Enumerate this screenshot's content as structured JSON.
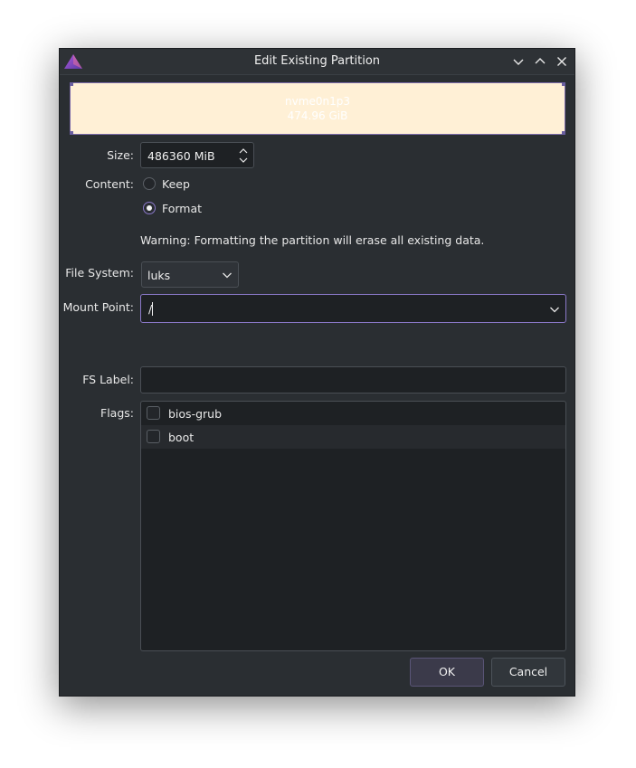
{
  "window": {
    "title": "Edit Existing Partition"
  },
  "partition": {
    "name": "nvme0n1p3",
    "size": "474.96 GiB",
    "color": "#fff0d6"
  },
  "form": {
    "size_label": "Size:",
    "size_value": "486360 MiB",
    "content_label": "Content:",
    "content_options": [
      "Keep",
      "Format"
    ],
    "content_selected": "Format",
    "warning": "Warning: Formatting the partition will erase all existing data.",
    "filesystem_label": "File System:",
    "filesystem_value": "luks",
    "mount_label": "Mount Point:",
    "mount_value": "/",
    "fslabel_label": "FS Label:",
    "fslabel_value": "",
    "flags_label": "Flags:",
    "flags": [
      {
        "label": "bios-grub",
        "checked": false
      },
      {
        "label": "boot",
        "checked": false
      }
    ]
  },
  "buttons": {
    "ok": "OK",
    "cancel": "Cancel"
  },
  "colors": {
    "accent": "#8a78c8",
    "background": "#2a2e32",
    "field": "#1e2124"
  }
}
